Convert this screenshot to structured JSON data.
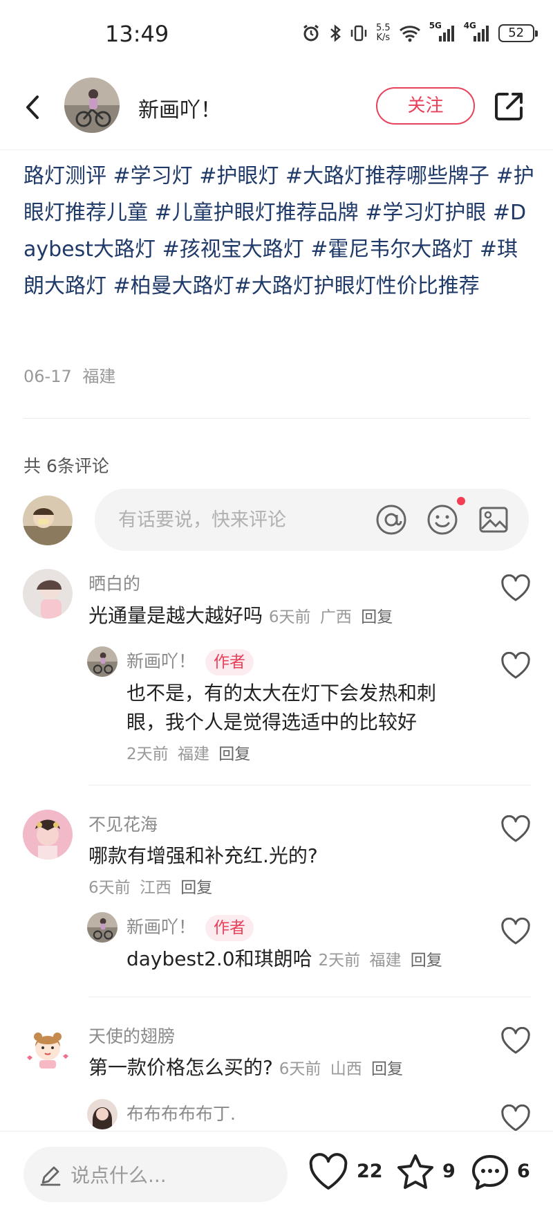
{
  "status_bar": {
    "time": "13:49",
    "net_speed_value": "5.5",
    "net_speed_unit": "K/s",
    "signal1": "5G",
    "signal2": "4G",
    "battery": "52"
  },
  "header": {
    "author_name": "新画吖！",
    "follow_label": "关注"
  },
  "post": {
    "tags_text": "路灯测评 #学习灯 #护眼灯 #大路灯推荐哪些牌子 #护眼灯推荐儿童 #儿童护眼灯推荐品牌 #学习灯护眼 #Daybest大路灯 #孩视宝大路灯 #霍尼韦尔大路灯 #琪朗大路灯 #柏曼大路灯#大路灯护眼灯性价比推荐",
    "date": "06-17",
    "location": "福建"
  },
  "comments_section": {
    "count_label": "共 6条评论",
    "input_placeholder": "有话要说，快来评论"
  },
  "comments": [
    {
      "name": "晒白的",
      "text": "光通量是越大越好吗",
      "time": "6天前",
      "location": "广西",
      "reply_label": "回复",
      "replies": [
        {
          "name": "新画吖！",
          "badge": "作者",
          "text_line1": "也不是，有的太大在灯下会发热和刺",
          "text_line2": "眼，我个人是觉得选适中的比较好",
          "time": "2天前",
          "location": "福建",
          "reply_label": "回复"
        }
      ]
    },
    {
      "name": "不见花海",
      "text": "哪款有增强和补充红.光的?",
      "time": "6天前",
      "location": "江西",
      "reply_label": "回复",
      "replies": [
        {
          "name": "新画吖！",
          "badge": "作者",
          "text": "daybest2.0和琪朗哈",
          "time": "2天前",
          "location": "福建",
          "reply_label": "回复"
        }
      ]
    },
    {
      "name": "天使的翅膀",
      "text": "第一款价格怎么买的?",
      "time": "6天前",
      "location": "山西",
      "reply_label": "回复",
      "replies": [
        {
          "name": "布布布布布丁."
        }
      ]
    }
  ],
  "bottom_bar": {
    "input_placeholder": "说点什么...",
    "likes": "22",
    "collects": "9",
    "comments": "6"
  },
  "colors": {
    "accent": "#e8415a",
    "tag_blue": "#1f3a68",
    "muted": "#999999"
  }
}
